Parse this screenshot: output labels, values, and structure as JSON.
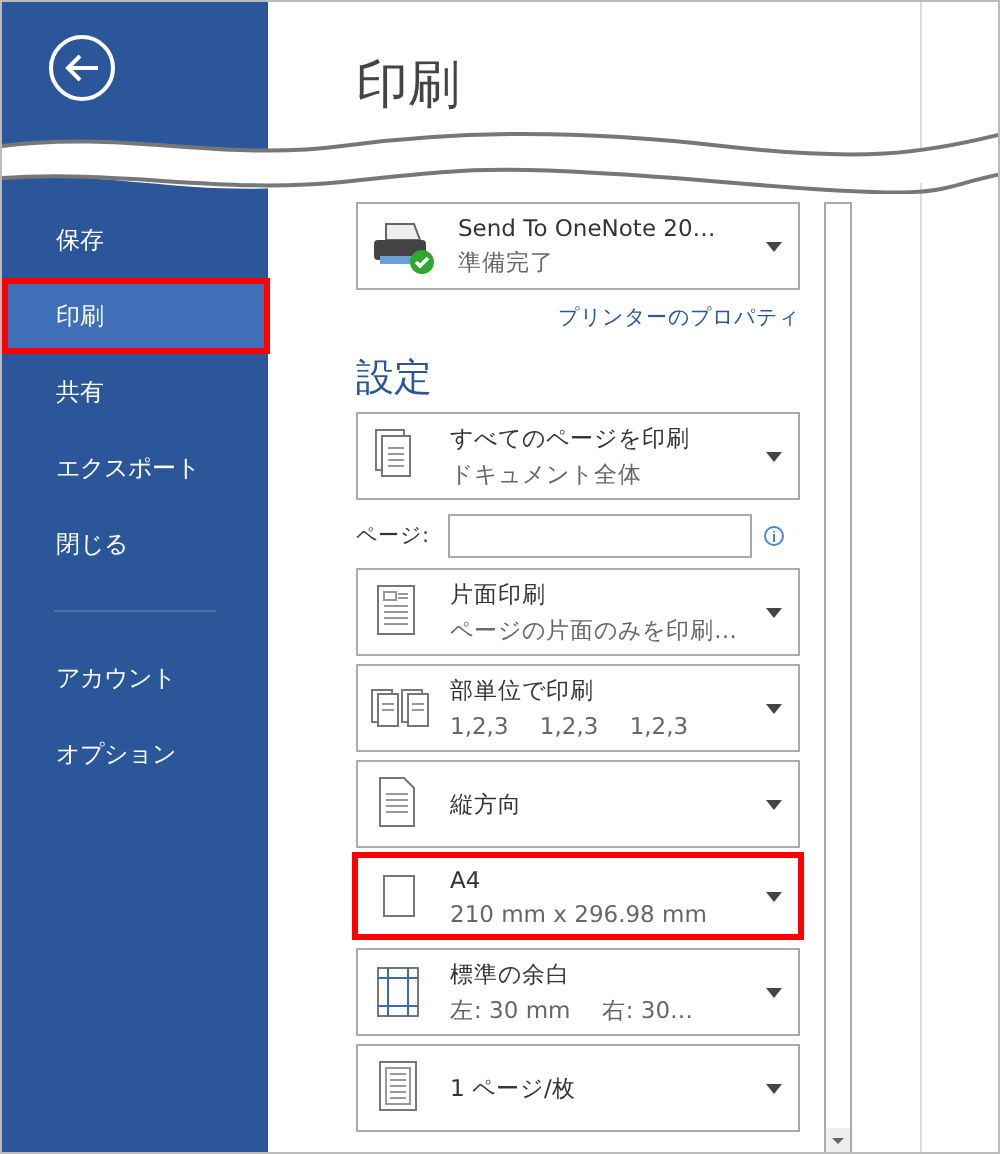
{
  "sidebar": {
    "items": [
      {
        "label": "保存",
        "selected": false,
        "highlighted": false
      },
      {
        "label": "印刷",
        "selected": true,
        "highlighted": true
      },
      {
        "label": "共有",
        "selected": false,
        "highlighted": false
      },
      {
        "label": "エクスポート",
        "selected": false,
        "highlighted": false
      },
      {
        "label": "閉じる",
        "selected": false,
        "highlighted": false
      }
    ],
    "lower_items": [
      {
        "label": "アカウント",
        "selected": false
      },
      {
        "label": "オプション",
        "selected": false
      }
    ]
  },
  "heading": "印刷",
  "printer": {
    "name": "Send To OneNote 20…",
    "status": "準備完了",
    "link": "プリンターのプロパティ"
  },
  "settings_heading": "設定",
  "settings": [
    {
      "kind": "dropdown",
      "title": "すべてのページを印刷",
      "subtitle": "ドキュメント全体",
      "highlighted": false
    },
    {
      "kind": "pages",
      "label": "ページ:"
    },
    {
      "kind": "dropdown",
      "title": "片面印刷",
      "subtitle": "ページの片面のみを印刷…",
      "highlighted": false
    },
    {
      "kind": "dropdown",
      "title": "部単位で印刷",
      "subtitle": "1,2,3　 1,2,3　 1,2,3",
      "highlighted": false
    },
    {
      "kind": "dropdown",
      "title": "縦方向",
      "highlighted": false
    },
    {
      "kind": "dropdown",
      "title": "A4",
      "subtitle": "210 mm x 296.98 mm",
      "highlighted": true
    },
    {
      "kind": "dropdown",
      "title": "標準の余白",
      "subtitle": "左:  30 mm　 右:  30…",
      "highlighted": false
    },
    {
      "kind": "dropdown",
      "title": "1 ページ/枚",
      "highlighted": false
    }
  ]
}
